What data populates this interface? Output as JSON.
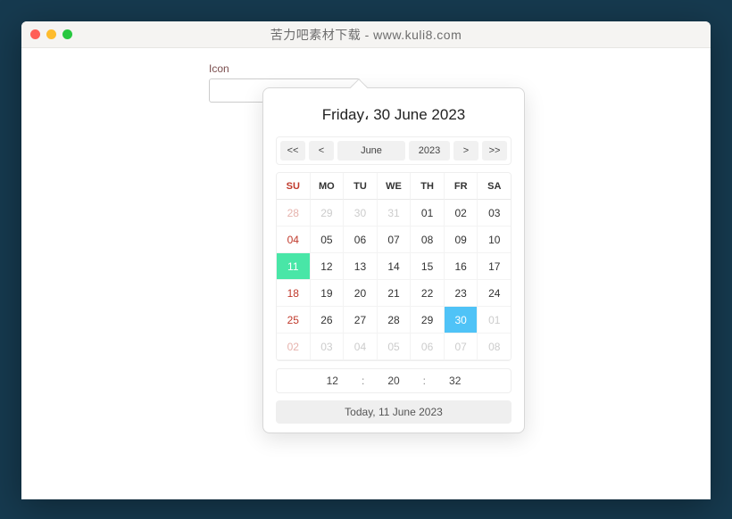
{
  "window": {
    "title": "苦力吧素材下载 - www.kuli8.com"
  },
  "field": {
    "label": "Icon",
    "value": ""
  },
  "datepicker": {
    "title": "Friday، 30 June 2023",
    "nav": {
      "prevYear": "<<",
      "prevMonth": "<",
      "month": "June",
      "year": "2023",
      "nextMonth": ">",
      "nextYear": ">>"
    },
    "dow": [
      "SU",
      "MO",
      "TU",
      "WE",
      "TH",
      "FR",
      "SA"
    ],
    "weeks": [
      [
        {
          "d": "28",
          "o": true
        },
        {
          "d": "29",
          "o": true
        },
        {
          "d": "30",
          "o": true
        },
        {
          "d": "31",
          "o": true
        },
        {
          "d": "01"
        },
        {
          "d": "02"
        },
        {
          "d": "03"
        }
      ],
      [
        {
          "d": "04"
        },
        {
          "d": "05"
        },
        {
          "d": "06"
        },
        {
          "d": "07"
        },
        {
          "d": "08"
        },
        {
          "d": "09"
        },
        {
          "d": "10"
        }
      ],
      [
        {
          "d": "11",
          "today": true
        },
        {
          "d": "12"
        },
        {
          "d": "13"
        },
        {
          "d": "14"
        },
        {
          "d": "15"
        },
        {
          "d": "16"
        },
        {
          "d": "17"
        }
      ],
      [
        {
          "d": "18"
        },
        {
          "d": "19"
        },
        {
          "d": "20"
        },
        {
          "d": "21"
        },
        {
          "d": "22"
        },
        {
          "d": "23"
        },
        {
          "d": "24"
        }
      ],
      [
        {
          "d": "25"
        },
        {
          "d": "26"
        },
        {
          "d": "27"
        },
        {
          "d": "28"
        },
        {
          "d": "29"
        },
        {
          "d": "30",
          "sel": true
        },
        {
          "d": "01",
          "o": true
        }
      ],
      [
        {
          "d": "02",
          "o": true
        },
        {
          "d": "03",
          "o": true
        },
        {
          "d": "04",
          "o": true
        },
        {
          "d": "05",
          "o": true
        },
        {
          "d": "06",
          "o": true
        },
        {
          "d": "07",
          "o": true
        },
        {
          "d": "08",
          "o": true
        }
      ]
    ],
    "time": {
      "h": "12",
      "m": "20",
      "s": "32"
    },
    "todayLabel": "Today, 11 June 2023"
  }
}
